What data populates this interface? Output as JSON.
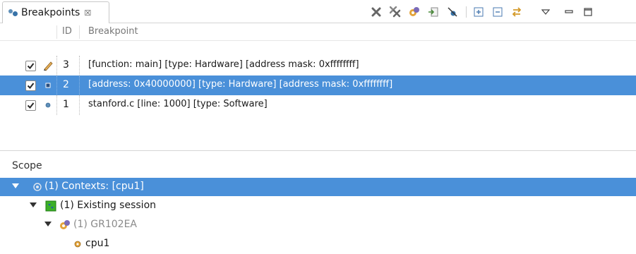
{
  "view": {
    "tab_title": "Breakpoints",
    "tab_close": "☒",
    "toolbar": [
      {
        "icon": "remove-icon"
      },
      {
        "icon": "remove-all-icon"
      },
      {
        "icon": "connect-icon"
      },
      {
        "icon": "import-icon"
      },
      {
        "icon": "skip-breakpoints-icon"
      },
      {
        "icon": "expand-all-icon"
      },
      {
        "icon": "collapse-all-icon"
      },
      {
        "icon": "link-with-debug-view-icon"
      },
      {
        "icon": "view-menu-icon"
      },
      {
        "icon": "minimize-icon"
      },
      {
        "icon": "maximize-icon"
      }
    ]
  },
  "table": {
    "headers": {
      "id": "ID",
      "breakpoint": "Breakpoint"
    },
    "rows": [
      {
        "checked": true,
        "icon": "pencil-icon",
        "id": "3",
        "text": "[function: main] [type: Hardware] [address mask: 0xffffffff]",
        "selected": false
      },
      {
        "checked": true,
        "icon": "hardware-breakpoint-icon",
        "id": "2",
        "text": "[address: 0x40000000] [type: Hardware] [address mask: 0xffffffff]",
        "selected": true
      },
      {
        "checked": true,
        "icon": "breakpoint-dot-icon",
        "id": "1",
        "text": "stanford.c [line: 1000] [type: Software]",
        "selected": false
      }
    ]
  },
  "scope": {
    "label": "Scope",
    "tree": [
      {
        "text": "(1) Contexts: [cpu1]",
        "icon": "contexts-icon",
        "selected": true
      },
      {
        "text": "(1) Existing session",
        "icon": "session-icon",
        "selected": false
      },
      {
        "text": "(1) GR102EA",
        "icon": "target-icon",
        "selected": false
      },
      {
        "text": "cpu1",
        "icon": "cpu-icon",
        "selected": false
      }
    ]
  },
  "colors": {
    "selection": "#4a90d9"
  }
}
